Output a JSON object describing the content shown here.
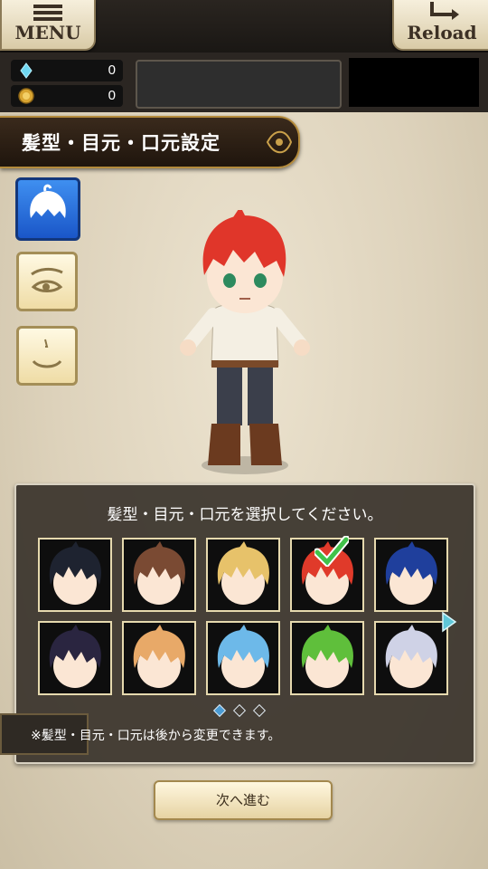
{
  "header": {
    "menu_label": "MENU",
    "reload_label": "Reload"
  },
  "currency": {
    "gems": "0",
    "coins": "0"
  },
  "title": "髪型・目元・口元設定",
  "panel": {
    "prompt": "髪型・目元・口元を選択してください。",
    "note": "※髪型・目元・口元は後から変更できます。",
    "page_count": 3,
    "current_page": 1
  },
  "next_button_label": "次へ進む",
  "side_tabs": [
    {
      "name": "hair-tab",
      "selected": true
    },
    {
      "name": "eyes-tab",
      "selected": false
    },
    {
      "name": "mouth-tab",
      "selected": false
    }
  ],
  "hair_options": [
    {
      "color": "#1e2330",
      "selected": false
    },
    {
      "color": "#7a4a33",
      "selected": false
    },
    {
      "color": "#e7c26a",
      "selected": false
    },
    {
      "color": "#e03a2a",
      "selected": true
    },
    {
      "color": "#1f3f9c",
      "selected": false
    },
    {
      "color": "#2a2540",
      "selected": false
    },
    {
      "color": "#e8a968",
      "selected": false
    },
    {
      "color": "#6db9e9",
      "selected": false
    },
    {
      "color": "#5fbf3b",
      "selected": false
    },
    {
      "color": "#cfd2e6",
      "selected": false
    }
  ],
  "colors": {
    "selected_tab": "#2f74e0",
    "check": "#41c24a",
    "panel_bg": "#3a342c"
  }
}
